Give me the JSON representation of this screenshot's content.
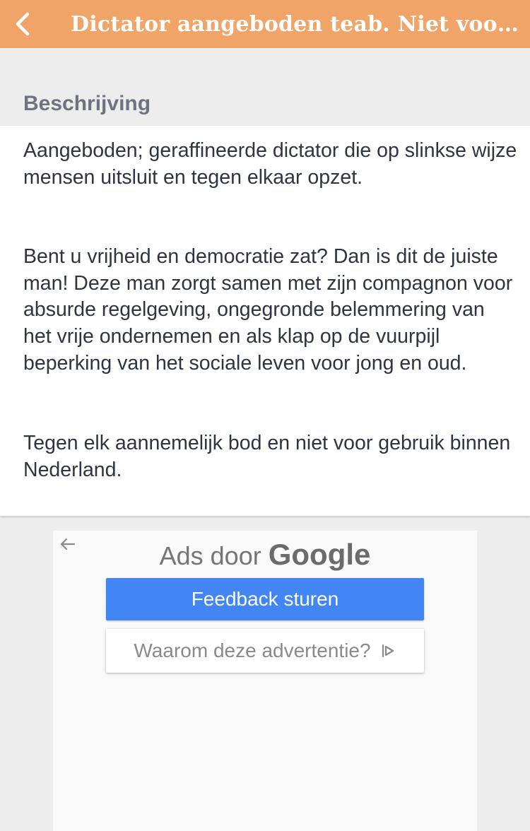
{
  "header": {
    "title": "Dictator aangeboden teab. Niet voor g...",
    "back_icon": "chevron-left-icon",
    "background_color": "#f0a468"
  },
  "section": {
    "label": "Beschrijving"
  },
  "description": {
    "paragraphs": [
      "Aangeboden; geraffineerde dictator die op slinkse wijze mensen uitsluit en tegen elkaar opzet.",
      "Bent u vrijheid en democratie zat? Dan is dit de juiste man! Deze man zorgt samen met zijn compagnon voor absurde regelgeving, ongegronde belemmering van het vrije ondernemen en als klap op de vuurpijl beperking van het sociale leven voor jong en oud.",
      "Tegen elk aannemelijk bod en niet voor gebruik binnen Nederland."
    ]
  },
  "ad": {
    "back_icon": "arrow-left-icon",
    "label_prefix": "Ads door",
    "label_brand": "Google",
    "feedback_button": "Feedback sturen",
    "why_button": "Waarom deze advertentie?",
    "why_icon": "adchoices-icon",
    "feedback_color": "#4285f4"
  }
}
